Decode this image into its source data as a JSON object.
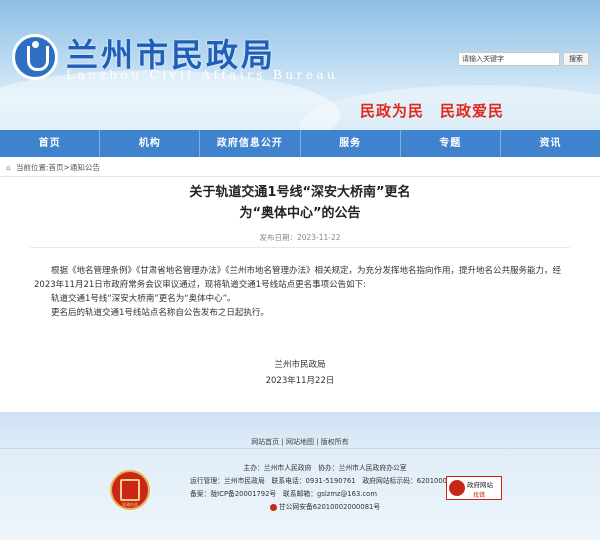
{
  "header": {
    "title": "兰州市民政局",
    "subtitle": "Lanzhou Civil Affairs Bureau",
    "search_placeholder": "请输入关键字",
    "search_button": "搜索",
    "slogan": "民政为民　民政爱民"
  },
  "nav": {
    "items": [
      "首页",
      "机构",
      "政府信息公开",
      "服务",
      "专题",
      "资讯"
    ]
  },
  "breadcrumb": {
    "label": "当前位置:",
    "path": "首页>通知公告"
  },
  "article": {
    "title_line1": "关于轨道交通1号线“深安大桥南”更名",
    "title_line2": "为“奥体中心”的公告",
    "publish_date": "发布日期：2023-11-22",
    "para1": "根据《地名管理条例》《甘肃省地名管理办法》《兰州市地名管理办法》相关规定，为充分发挥地名指向作用，提升地名公共服务能力，经2023年11月21日市政府常务会议审议通过，现将轨道交通1号线站点更名事项公告如下:",
    "para2": "轨道交通1号线“深安大桥南”更名为“奥体中心”。",
    "para3": "更名后的轨道交通1号线站点名称自公告发布之日起执行。",
    "signature_org": "兰州市民政局",
    "signature_date": "2023年11月22日"
  },
  "footer": {
    "links": "网站首页 | 网站地图 | 版权所有",
    "sponsor": "主办：兰州市人民政府　协办：兰州市人民政府办公室",
    "operator": "运行管理：兰州市民政局　联系电话：0931-5190761　政府网站标示码：6201000017",
    "icp": "备案：陇ICP备20001792号　联系邮箱：gslzmz@163.com",
    "police": "甘公网安备62010002000081号",
    "emblem_label": "党政机关",
    "badge_title": "政府网站",
    "badge_sub": "找错"
  },
  "colors": {
    "primary_blue": "#3f82cd",
    "title_blue": "#1f5fb8",
    "slogan_red": "#e02a1c"
  }
}
